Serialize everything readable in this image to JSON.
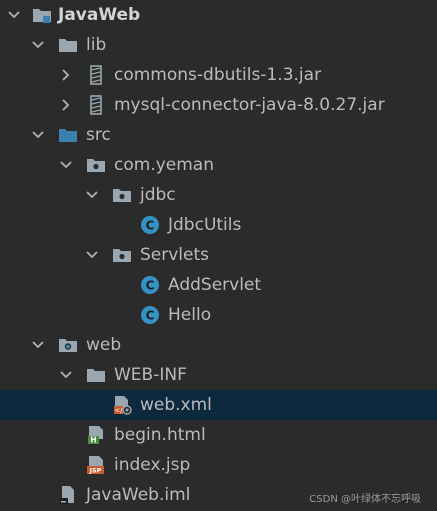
{
  "tree": {
    "root": {
      "label": "JavaWeb"
    },
    "lib": {
      "label": "lib"
    },
    "jar1": {
      "label": "commons-dbutils-1.3.jar"
    },
    "jar2": {
      "label": "mysql-connector-java-8.0.27.jar"
    },
    "src": {
      "label": "src"
    },
    "pkg": {
      "label": "com.yeman"
    },
    "jdbc": {
      "label": "jdbc"
    },
    "jdbcutils": {
      "label": "JdbcUtils"
    },
    "servlets": {
      "label": "Servlets"
    },
    "addservlet": {
      "label": "AddServlet"
    },
    "hello": {
      "label": "Hello"
    },
    "web": {
      "label": "web"
    },
    "webinf": {
      "label": "WEB-INF"
    },
    "webxml": {
      "label": "web.xml"
    },
    "begin": {
      "label": "begin.html"
    },
    "index": {
      "label": "index.jsp"
    },
    "iml": {
      "label": "JavaWeb.iml"
    }
  },
  "watermark": "CSDN @叶绿体不忘呼吸",
  "colors": {
    "background": "#2b2b2b",
    "selection": "#0d293e",
    "text": "#bbbbbb",
    "class_icon": "#3592c4",
    "source_folder": "#3c7fb1",
    "folder": "#9aa7b0"
  }
}
